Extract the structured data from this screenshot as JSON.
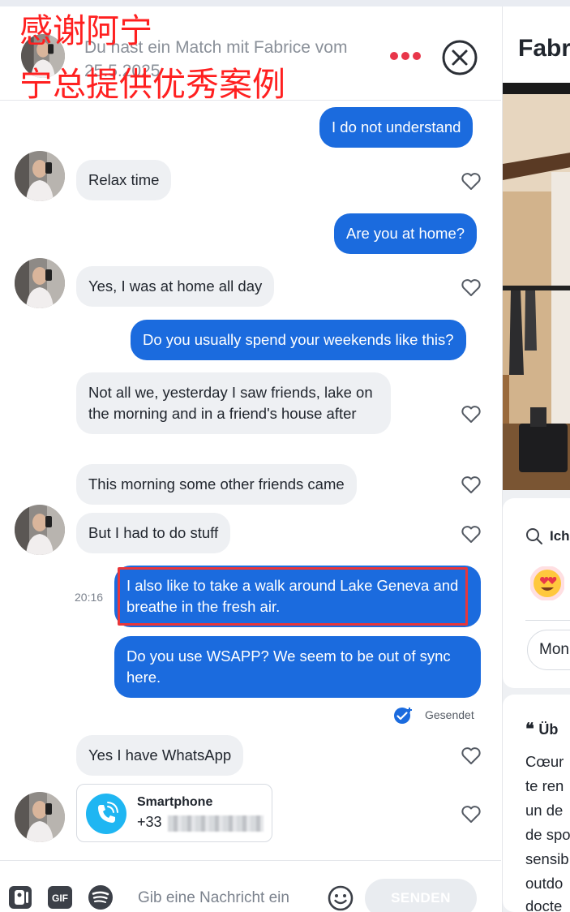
{
  "header": {
    "match_text": "Du hast ein Match mit Fabrice vom 25.5.2025",
    "more_icon": "more-dots-icon",
    "close_icon": "close-circle-icon",
    "accent_color": "#e8364a"
  },
  "watermark": {
    "line1": "感谢阿宁",
    "line2": "宁总提供优秀案例"
  },
  "messages": [
    {
      "dir": "out",
      "text": "I do not understand"
    },
    {
      "dir": "in",
      "text": "Relax time",
      "liked": false
    },
    {
      "dir": "out",
      "text": "Are you at home?"
    },
    {
      "dir": "in",
      "text": "Yes, I was at home all day",
      "liked": false
    },
    {
      "dir": "out",
      "text": "Do you usually spend your weekends like this?"
    },
    {
      "dir": "in",
      "text": "Not all we, yesterday I saw friends, lake on the morning and in a friend's house after",
      "liked": false
    },
    {
      "dir": "in",
      "text": "This morning some other friends came",
      "liked": false
    },
    {
      "dir": "in",
      "text": "But I had to do stuff",
      "liked": false
    },
    {
      "dir": "out",
      "text": "I also like to take a walk around Lake Geneva and breathe in the fresh air.",
      "time": "20:16",
      "highlighted": true
    },
    {
      "dir": "out",
      "text": "Do you use WSAPP? We seem to be out of sync here."
    },
    {
      "dir": "in",
      "text": "Yes I have WhatsApp",
      "liked": false
    }
  ],
  "sent_status": "Gesendet",
  "contact_card": {
    "title": "Smartphone",
    "number_prefix": "+33",
    "icon": "phone-call-icon"
  },
  "composer": {
    "placeholder": "Gib eine Nachricht ein",
    "send_label": "SENDEN",
    "icons": [
      "contact-card-icon",
      "gif-icon",
      "spotify-icon",
      "emoji-icon"
    ]
  },
  "profile": {
    "name_partial": "Fabr",
    "search_label_partial": "Ich",
    "chip_partial": "Mon",
    "bio_heading_partial": "Üb",
    "bio_lines": [
      "Cœur",
      "te ren",
      "un de",
      "de spo",
      "sensib",
      "outdo",
      "docte"
    ]
  },
  "colors": {
    "outgoing_bubble": "#1b6bde",
    "incoming_bubble": "#eef0f3",
    "highlight_border": "#e8363a",
    "watermark": "#ff2020"
  }
}
